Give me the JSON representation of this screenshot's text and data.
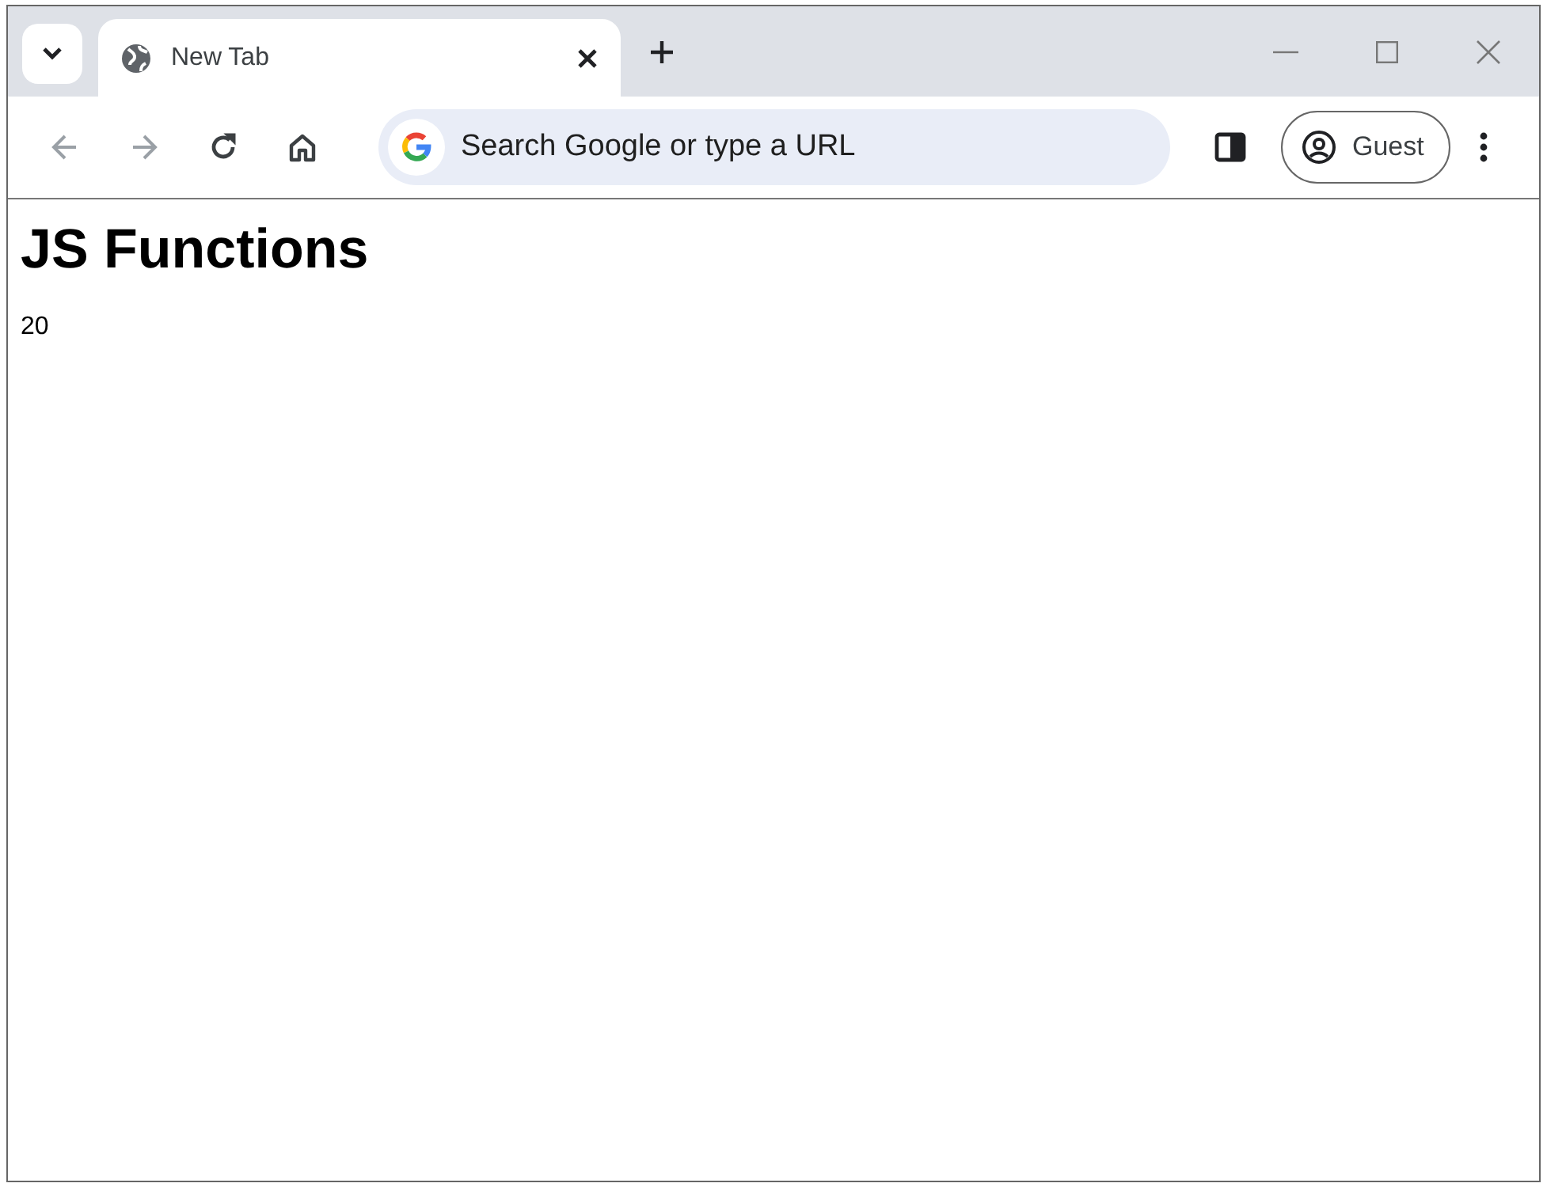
{
  "tabs": [
    {
      "title": "New Tab",
      "selected": true
    }
  ],
  "nav_buttons": [
    {
      "kind": "back",
      "disabled": true
    },
    {
      "kind": "forward",
      "disabled": true
    },
    {
      "kind": "reload",
      "disabled": false
    },
    {
      "kind": "home",
      "disabled": false
    }
  ],
  "address_bar": {
    "placeholder": "Search Google or type a URL"
  },
  "profile": {
    "label": "Guest"
  },
  "page": {
    "heading": "JS Functions",
    "output": "20"
  }
}
